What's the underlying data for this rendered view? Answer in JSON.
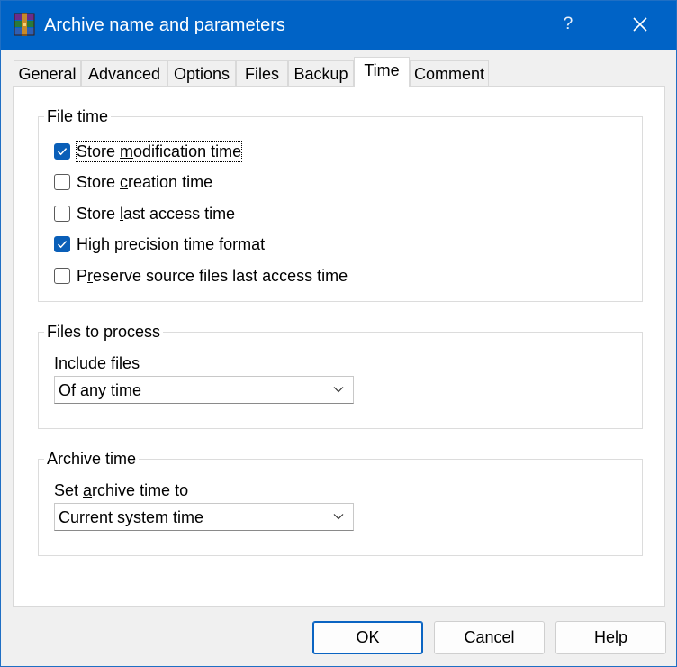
{
  "window": {
    "title": "Archive name and parameters",
    "help_label": "?",
    "close_icon": "close-icon",
    "app_icon": "winrar-icon"
  },
  "tabs": [
    {
      "label": "General"
    },
    {
      "label": "Advanced"
    },
    {
      "label": "Options"
    },
    {
      "label": "Files"
    },
    {
      "label": "Backup"
    },
    {
      "label": "Time",
      "active": true
    },
    {
      "label": "Comment"
    }
  ],
  "file_time": {
    "title": "File time",
    "options": [
      {
        "label_pre": "Store ",
        "label_u": "m",
        "label_post": "odification time",
        "checked": true
      },
      {
        "label_pre": "Store ",
        "label_u": "c",
        "label_post": "reation time",
        "checked": false
      },
      {
        "label_pre": "Store ",
        "label_u": "l",
        "label_post": "ast access time",
        "checked": false
      },
      {
        "label_pre": "High ",
        "label_u": "p",
        "label_post": "recision time format",
        "checked": true
      },
      {
        "label_pre": "P",
        "label_u": "r",
        "label_post": "eserve source files last access time",
        "checked": false
      }
    ]
  },
  "files_to_process": {
    "title": "Files to process",
    "field_label_pre": "Include ",
    "field_label_u": "f",
    "field_label_post": "iles",
    "selected": "Of any time"
  },
  "archive_time": {
    "title": "Archive time",
    "field_label_pre": "Set ",
    "field_label_u": "a",
    "field_label_post": "rchive time to",
    "selected": "Current system time"
  },
  "buttons": {
    "ok": "OK",
    "cancel": "Cancel",
    "help": "Help"
  },
  "colors": {
    "titlebar": "#0063c6",
    "checkbox_checked": "#0a5fb8"
  }
}
